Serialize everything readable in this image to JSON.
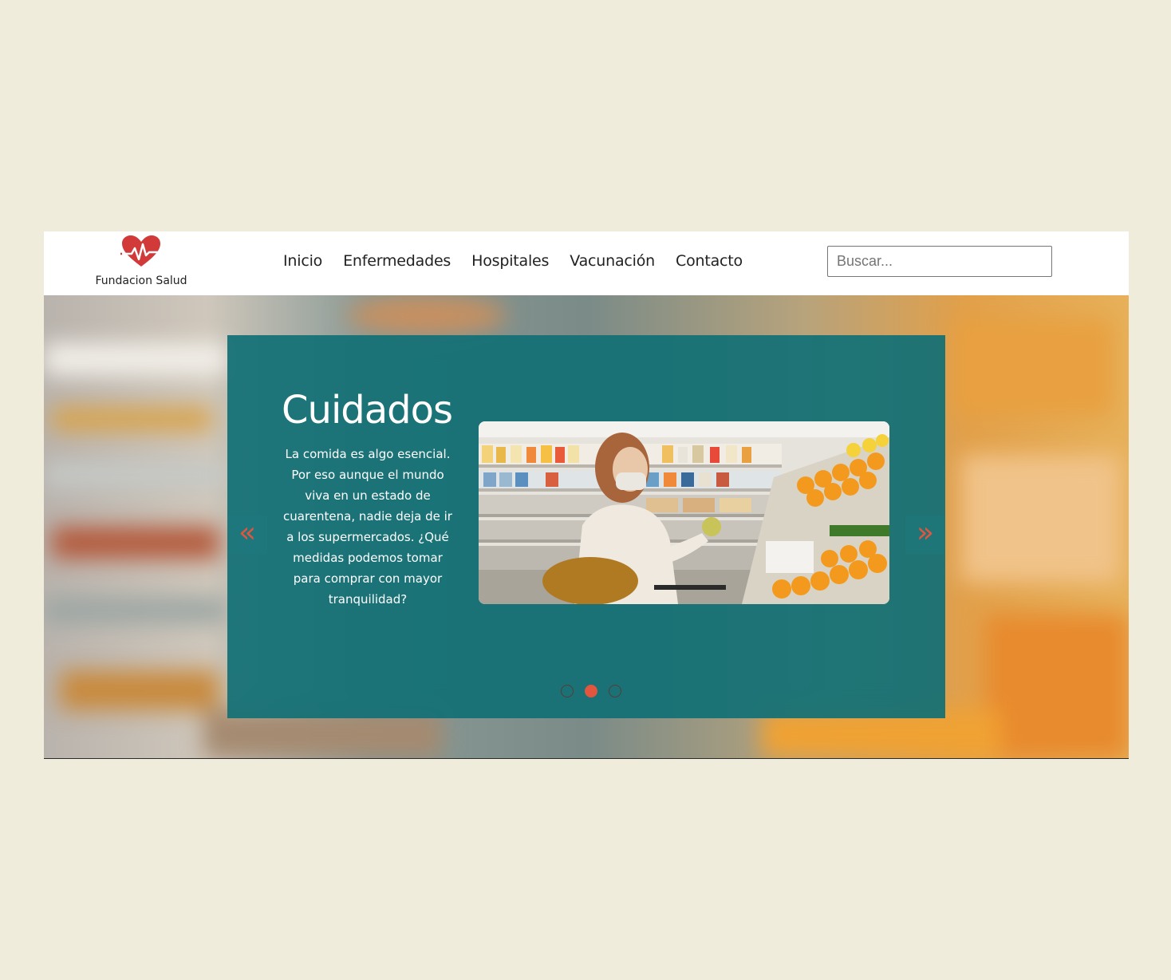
{
  "brand": {
    "name": "Fundacion Salud",
    "logo_icon": "heart-pulse-icon",
    "logo_color": "#d23a3a"
  },
  "nav": {
    "items": [
      {
        "label": "Inicio"
      },
      {
        "label": "Enfermedades"
      },
      {
        "label": "Hospitales"
      },
      {
        "label": "Vacunación"
      },
      {
        "label": "Contacto"
      }
    ]
  },
  "search": {
    "placeholder": "Buscar...",
    "value": ""
  },
  "carousel": {
    "title": "Cuidados",
    "text": "La comida es algo esencial. Por eso aunque el mundo viva en un estado de cuarentena, nadie deja de ir a los supermercados. ¿Qué medidas podemos tomar para comprar con mayor tranquilidad?",
    "prev_label": "«",
    "next_label": "»",
    "slide_count": 3,
    "active_slide": 2,
    "panel_color": "#127075",
    "accent_color": "#e2553f"
  },
  "colors": {
    "page_background": "#f0ecdb",
    "header_background": "#ffffff"
  }
}
